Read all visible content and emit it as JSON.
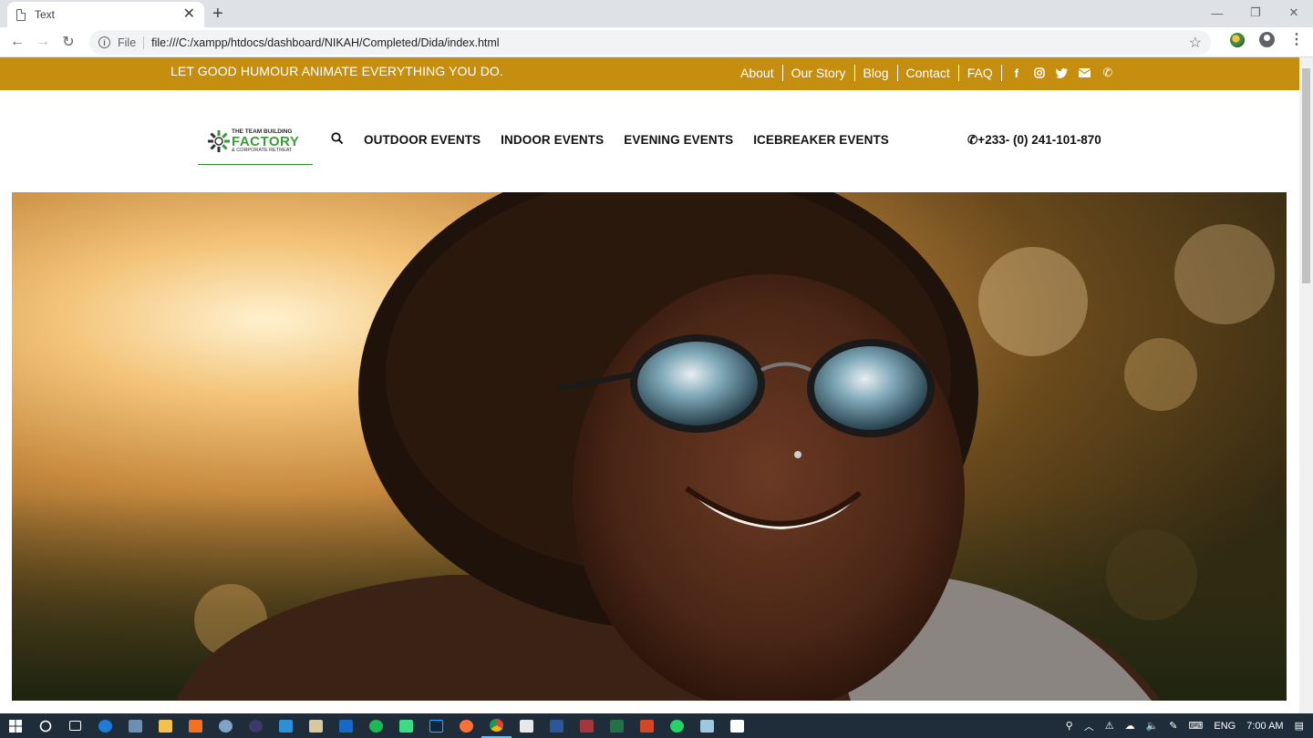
{
  "browser": {
    "tab_title": "Text",
    "tab_close": "✕",
    "new_tab": "+",
    "window_controls": {
      "minimize": "—",
      "restore": "❐",
      "close": "✕"
    },
    "nav": {
      "back": "←",
      "forward": "→",
      "reload": "↻"
    },
    "omnibox": {
      "info": "i",
      "scheme": "File",
      "url": "file:///C:/xampp/htdocs/dashboard/NIKAH/Completed/Dida/index.html",
      "star": "☆"
    },
    "menu": "⋮"
  },
  "page": {
    "tagline": "LET GOOD HUMOUR ANIMATE EVERYTHING YOU DO.",
    "top_links": [
      "About",
      "Our Story",
      "Blog",
      "Contact",
      "FAQ"
    ],
    "social_icons": [
      "facebook-icon",
      "instagram-icon",
      "twitter-icon",
      "envelope-icon",
      "phone-icon"
    ],
    "social_glyphs": [
      "f",
      "◎",
      "🐦",
      "✉",
      "✆"
    ],
    "logo": {
      "line1": "THE TEAM BUILDING",
      "line2": "FACTORY",
      "line3": "& CORPORATE RETREAT"
    },
    "main_nav": [
      "OUTDOOR EVENTS",
      "INDOOR EVENTS",
      "EVENING EVENTS",
      "ICEBREAKER EVENTS"
    ],
    "phone": "✆+233- (0) 241-101-870",
    "hero_image": "smiling-woman-sunglasses-photo"
  },
  "colors": {
    "topbar": "#c68e0e",
    "logo_green": "#3a9b3a",
    "taskbar": "#1f2d3a"
  },
  "taskbar": {
    "tray": {
      "language": "ENG",
      "time": "7:00 AM"
    }
  }
}
